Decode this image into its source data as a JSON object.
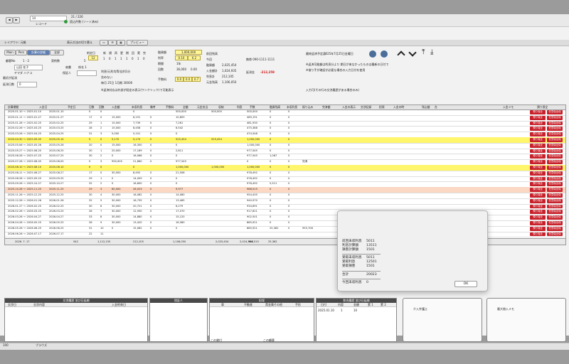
{
  "header": {
    "record_nav": "21 / 226",
    "record_label": "レコード",
    "found_label": "読込件数 (ソート済み)",
    "left_counter": "14",
    "layout_label": "レイアウト: 元帳",
    "view_label": "表示方法の切り替え",
    "preview_btn": "プレビュー",
    "tabs": [
      "Main",
      "Pers",
      "計算の詳細",
      "全部"
    ]
  },
  "customer": {
    "code_label": "顧客No",
    "code_value": "1 - 2",
    "name": "山田 花子",
    "kana": "ヤマダ ハナコ",
    "contract_label": "契約数",
    "contract_value": "5",
    "title_label": "肩書",
    "title_value": "係名 1",
    "guarantor_label": "保証人",
    "overdue_label": "最初が延滞",
    "overdue_value": "0",
    "due_day_label": "延滞日数",
    "due_day_value": "60",
    "labels": [
      "約定日",
      "開始",
      "口座"
    ],
    "date_headers": [
      "新",
      "規",
      "再",
      "更",
      "期",
      "回",
      "実",
      "完"
    ],
    "date_values": [
      "1",
      "0",
      "1",
      "1",
      "1",
      "0",
      "1",
      "0"
    ],
    "notes": [
      "利息/元利均等/自利1分",
      "含めない",
      "毎月 25日 1月期 30000"
    ],
    "note_link": "※返済対応は外部が既定の表示(ワンクリック)で可能表示"
  },
  "loan": {
    "amount_label": "融資額",
    "amount_value": "1,000,000",
    "rate_label": "利率",
    "rate_a": "0.10",
    "rate_b": "6.2",
    "term_label": "期間",
    "term_value": "1年",
    "count_label": "回数",
    "count_value": "36,000",
    "count_unit": "0.00",
    "fee_label": "手数料",
    "fee_a": "0.0",
    "fee_b": "0.0",
    "fee_c": "0.7"
  },
  "summary": {
    "col1_labels": [
      "融資額",
      "入金額計",
      "利息計",
      "元金残高"
    ],
    "col1_values": [
      "2,025,454",
      "1,024,935",
      "212,105",
      "1,106,050"
    ],
    "col2_labels": [
      "前回残高",
      "今回"
    ],
    "overdue_amount_label": "延滞金",
    "overdue_amount": "-212,259",
    "phone_label": "携帯 090-1111-1111",
    "last_paid_label": "最終返済予定日",
    "last_paid": "2025年7月25日金曜日",
    "hint1": "※返済可能額は利息分より 期日が来なかったものは最新の日付で",
    "hint2": "※借り手が確認が必要な場合の入力日付を使用",
    "input_hint": "入力可(その行の交渉履歴がある場合のみ)"
  },
  "grid": {
    "headers": [
      "計算期間",
      "入金日",
      "予定日",
      "日数",
      "回数",
      "入金額",
      "未収利息",
      "備考",
      "手数料",
      "全額",
      "元金充当",
      "収納",
      "利息",
      "手数",
      "融資残高",
      "未収利息",
      "振り込み",
      "完済額",
      "入金の表示",
      "交渉記録",
      "担保",
      "入金の時",
      "残込額",
      "台",
      "入金メモ",
      "預り保全"
    ],
    "rows": [
      {
        "s": "",
        "p": "2025.01.10 ～ 2025.01.10",
        "d": "2025.01.10",
        "n": "0",
        "c": "0",
        "a": "",
        "i": "0",
        "m": "",
        "k": "500,000",
        "b": "500,000",
        "bal": "500,000",
        "r": "0",
        "z": "0",
        "f": "",
        "red": [
          "預り保全",
          "任意保全保"
        ]
      },
      {
        "s": "",
        "p": "2025.01.11 ～ 2025.01.27",
        "d": "2025.01.27",
        "n": "17",
        "c": "0",
        "a": "15,000",
        "i": "6,191",
        "m": "0",
        "k": "",
        "b": "10,809",
        "bal": "489,191",
        "r": "0",
        "z": "0",
        "f": "",
        "red": [
          "預り保全",
          "任意保全保"
        ]
      },
      {
        "s": "",
        "p": "2025.01.28 ～ 2025.02.25",
        "d": "2025.02.25",
        "n": "29",
        "c": "1",
        "a": "15,000",
        "i": "7,739",
        "m": "0",
        "k": "",
        "b": "7,261",
        "bal": "481,930",
        "r": "0",
        "z": "0",
        "f": "",
        "red": [
          "預り保全",
          "任意保全保"
        ]
      },
      {
        "s": "",
        "p": "2025.02.26 ～ 2025.03.25",
        "d": "2025.03.25",
        "n": "28",
        "c": "2",
        "a": "15,000",
        "i": "8,458",
        "m": "0",
        "k": "",
        "b": "6,542",
        "bal": "475,388",
        "r": "0",
        "z": "0",
        "f": "",
        "red": [
          "預り保全",
          "任意保全保"
        ]
      },
      {
        "s": "",
        "p": "2025.03.26 ～ 2025.04.25",
        "d": "2025.04.25",
        "n": "31",
        "c": "3",
        "a": "5,000",
        "i": "5,101",
        "m": "0",
        "k": "",
        "b": "0",
        "bal": "474,548",
        "r": "0",
        "z": "0",
        "f": "",
        "red": [
          "預り保全",
          "任意保全保"
        ]
      },
      {
        "s": "y",
        "p": "2025.04.30 ～ 2025.05.05",
        "d": "2025.05.14",
        "n": "5",
        "c": "0",
        "a": "5,170",
        "i": "5,170",
        "m": "0",
        "k": "525,454",
        "b": "525,454",
        "bal": "1,000,000",
        "r": "0",
        "z": "0",
        "f": "",
        "red": [
          "預り保全",
          "任意保全保"
        ]
      },
      {
        "s": "",
        "p": "2025.05.06 ～ 2025.05.26",
        "d": "2025.05.26",
        "n": "20",
        "c": "0",
        "a": "15,000",
        "i": "16,350",
        "m": "0",
        "k": "",
        "b": "0",
        "bal": "1,000,000",
        "r": "0",
        "z": "0",
        "f": "",
        "red": [
          "預り保全",
          "任意保全保"
        ]
      },
      {
        "s": "",
        "p": "2025.05.27 ～ 2025.06.25",
        "d": "2025.06.25",
        "n": "30",
        "c": "1",
        "a": "20,000",
        "i": "17,169",
        "m": "0",
        "k": "",
        "b": "2,811",
        "bal": "977,545",
        "r": "0",
        "z": "0",
        "f": "",
        "red": [
          "預り保全",
          "任意保全保"
        ]
      },
      {
        "s": "",
        "p": "2025.06.26 ～ 2025.07.25",
        "d": "2025.07.25",
        "n": "30",
        "c": "2",
        "a": "0",
        "i": "16,066",
        "m": "0",
        "k": "",
        "b": "0",
        "bal": "977,545",
        "r": "1,067",
        "z": "0",
        "f": "",
        "red": [
          "預り保全",
          "任意保全保"
        ]
      },
      {
        "s": "",
        "p": "2025.07.28 ～ 2025.08.05",
        "d": "2025.08.05",
        "n": "9",
        "c": "3",
        "a": "990,905",
        "i": "21,660",
        "m": "0",
        "k": "",
        "b": "977,545",
        "bal": "0",
        "r": "0",
        "z": "0",
        "f": "完済",
        "red": [
          "預り保全",
          "任意保全保"
        ]
      },
      {
        "s": "y",
        "p": "2025.08.10 ～ 2025.08.10",
        "d": "2025.08.10",
        "n": "0",
        "c": "0",
        "a": "",
        "i": "0",
        "m": "",
        "k": "1,000,000",
        "b": "1,000,000",
        "bal": "1,000,000",
        "r": "0",
        "z": "0",
        "f": "",
        "red": [
          "預り保全",
          "任意保全保"
        ]
      },
      {
        "s": "",
        "p": "2025.08.11 ～ 2025.08.27",
        "d": "2025.08.27",
        "n": "17",
        "c": "0",
        "a": "30,000",
        "i": "8,492",
        "m": "0",
        "k": "",
        "b": "21,508",
        "bal": "978,492",
        "r": "0",
        "z": "0",
        "f": "",
        "red": [
          "預り保全",
          "任意保全保"
        ]
      },
      {
        "s": "",
        "p": "2025.08.28 ～ 2025.09.25",
        "d": "2025.09.25",
        "n": "29",
        "c": "1",
        "a": "0",
        "i": "14,009",
        "m": "0",
        "k": "",
        "b": "0",
        "bal": "978,492",
        "r": "0",
        "z": "0",
        "f": "",
        "red": [
          "預り保全",
          "任意保全保"
        ]
      },
      {
        "s": "",
        "p": "2025.09.26 ～ 2025.10.27",
        "d": "2025.10.27",
        "n": "32",
        "c": "2",
        "a": "0",
        "i": "16,600",
        "m": "0",
        "k": "",
        "b": "0",
        "bal": "978,492",
        "r": "5,511",
        "z": "0",
        "f": "",
        "red": [
          "預り保全",
          "任意保全保"
        ]
      },
      {
        "s": "p",
        "p": "2025.10.28 ～ 2025.11.25",
        "d": "2025.11.25",
        "n": "29",
        "c": "3",
        "a": "60,000",
        "i": "26,023",
        "m": "0",
        "k": "",
        "b": "9,977",
        "bal": "968,515",
        "r": "0",
        "z": "0",
        "f": "",
        "red": [
          "預り保全",
          "任意保全保"
        ]
      },
      {
        "s": "",
        "p": "2025.11.26 ～ 2025.12.25",
        "d": "2025.12.25",
        "n": "30",
        "c": "4",
        "a": "30,000",
        "i": "16,082",
        "m": "0",
        "k": "",
        "b": "14,080",
        "bal": "954,435",
        "r": "0",
        "z": "0",
        "f": "",
        "red": [
          "預り保全",
          "任意保全保"
        ]
      },
      {
        "s": "",
        "p": "2025.12.26 ～ 2026.01.26",
        "d": "2026.01.26",
        "n": "32",
        "c": "5",
        "a": "30,000",
        "i": "16,735",
        "m": "0",
        "k": "",
        "b": "13,465",
        "bal": "940,970",
        "r": "0",
        "z": "0",
        "f": "",
        "red": [
          "預り保全",
          "任意保全保"
        ]
      },
      {
        "s": "",
        "p": "2026.01.27 ～ 2026.02.25",
        "d": "2026.02.25",
        "n": "30",
        "c": "6",
        "a": "30,000",
        "i": "20,721",
        "m": "0",
        "k": "",
        "b": "6,279",
        "bal": "934,691",
        "r": "0",
        "z": "0",
        "f": "",
        "red": [
          "預り保全",
          "任意保全保"
        ]
      },
      {
        "s": "",
        "p": "2026.02.26 ～ 2026.03.25",
        "d": "2026.03.25",
        "n": "28",
        "c": "7",
        "a": "30,000",
        "i": "12,930",
        "m": "0",
        "k": "",
        "b": "17,070",
        "bal": "917,621",
        "r": "0",
        "z": "0",
        "f": "",
        "red": [
          "預り保全",
          "任意保全保"
        ]
      },
      {
        "s": "",
        "p": "2026.03.26 ～ 2026.04.27",
        "d": "2026.04.27",
        "n": "33",
        "c": "8",
        "a": "30,000",
        "i": "14,880",
        "m": "0",
        "k": "",
        "b": "15,120",
        "bal": "902,501",
        "r": "0",
        "z": "0",
        "f": "",
        "red": [
          "預り保全",
          "任意保全保"
        ]
      },
      {
        "s": "",
        "p": "2026.04.28 ～ 2026.05.25",
        "d": "2026.05.25",
        "n": "28",
        "c": "9",
        "a": "30,000",
        "i": "13,420",
        "m": "0",
        "k": "",
        "b": "16,580",
        "bal": "885,921",
        "r": "0",
        "z": "0",
        "f": "",
        "red": [
          "預り保全",
          "任意保全保"
        ]
      },
      {
        "s": "",
        "p": "2026.05.26 ～ 2026.06.25",
        "d": "2026.06.25",
        "n": "31",
        "c": "10",
        "a": "0",
        "i": "15,082",
        "m": "0",
        "k": "",
        "b": "0",
        "bal": "885,921",
        "r": "25,362",
        "z": "0",
        "f": "955,706",
        "red": [
          "預り保全",
          "任意保全保"
        ]
      },
      {
        "s": "",
        "p": "2026.06.26 ～ 2026.07.17",
        "d": "2026.07.17",
        "n": "22",
        "c": "11",
        "a": "",
        "i": "",
        "m": "",
        "k": "",
        "b": "",
        "bal": "",
        "r": "",
        "z": "",
        "f": "",
        "red": [
          "預り保全",
          "任意保全保"
        ]
      }
    ],
    "total": {
      "d": "2026. 7. 17",
      "n": "542",
      "a": "1,112,155",
      "i": "212,105",
      "b": "1,106,050",
      "k": "2,025,454",
      "k2": "2,024,394",
      "bal": "968,515",
      "r": "25,362"
    }
  },
  "dialog": {
    "lines": [
      {
        "label": "前回未収利息",
        "value": "5011"
      },
      {
        "label": "利息計算額",
        "value": "13511"
      },
      {
        "label": "損害計算額",
        "value": "1501"
      },
      {
        "label": "受取未収利息",
        "value": "5011"
      },
      {
        "label": "受取利息",
        "value": "12501"
      },
      {
        "label": "受取損害",
        "value": "1501"
      },
      {
        "label": "合計",
        "value": "20023"
      },
      {
        "label": "今回未収利息",
        "value": "0"
      }
    ],
    "ok": "OK"
  },
  "bottom": {
    "p1": {
      "title": "交渉履歴 並び日延順",
      "cols": [
        "交渉日",
        "交渉内容",
        "入金約束日"
      ]
    },
    "p2": {
      "title": "保証人"
    },
    "p3": {
      "title": "担保",
      "cols": [
        "車",
        "不動産",
        "貴金属その他",
        "手形"
      ]
    },
    "p4": {
      "title": "和合履歴 並び日延順",
      "cols": [
        "日付",
        "内容",
        "金額",
        "累 1",
        "累 2"
      ],
      "row": [
        "2025.01.10",
        "1",
        "10"
      ]
    },
    "p5": {
      "title": "介入弁護士"
    },
    "p6": {
      "title": "最大借入メモ"
    },
    "footer1": "この貸付",
    "footer2": "この顧客",
    "zoom": "100",
    "mode": "ブラウズ"
  }
}
